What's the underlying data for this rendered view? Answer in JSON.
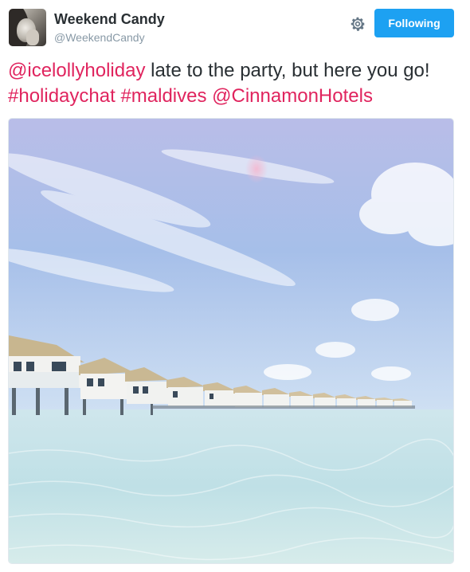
{
  "header": {
    "display_name": "Weekend Candy",
    "handle": "@WeekendCandy",
    "follow_label": "Following"
  },
  "tweet": {
    "mention_1": "@icelollyholiday",
    "text_1": " late to the party, but here you go! ",
    "hashtag_1": "#holidaychat",
    "hashtag_2": "#maldives",
    "mention_2": "@CinnamonHotels"
  },
  "colors": {
    "link": "#e0245e",
    "button": "#1da1f2",
    "text": "#292f33",
    "muted": "#8899a6"
  },
  "icons": {
    "settings": "gear-icon",
    "avatar": "user-avatar"
  }
}
